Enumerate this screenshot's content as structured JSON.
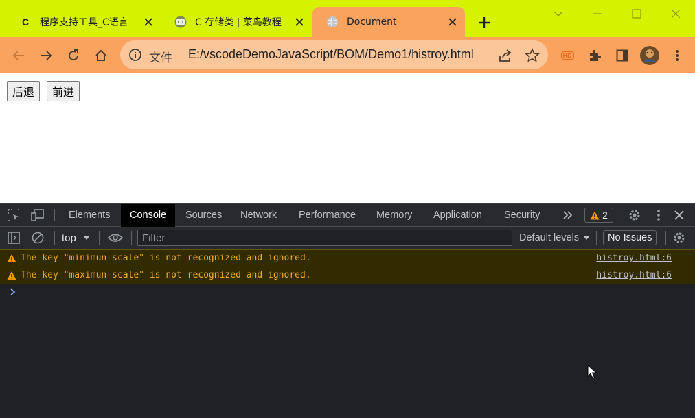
{
  "colors": {
    "tab_strip": "#d5f200",
    "toolbar": "#f9a35f",
    "omnibox": "#fbc69a",
    "devtools_bg": "#202124",
    "warning_text": "#f2ab26",
    "warning_bg": "#332b00"
  },
  "tabs": [
    {
      "icon": "c-letter-icon",
      "favicon_text": "C",
      "title": "程序支持工具_C语言",
      "active": false
    },
    {
      "icon": "code-icon",
      "title": "C 存储类 | 菜鸟教程",
      "active": false
    },
    {
      "icon": "globe-icon",
      "title": "Document",
      "active": true
    }
  ],
  "toolbar": {
    "omnibox_label": "文件",
    "url": "E:/vscodeDemoJavaScript/BOM/Demo1/histroy.html",
    "hd_badge": "HD"
  },
  "page": {
    "back_button": "后退",
    "forward_button": "前进"
  },
  "devtools": {
    "tabs": [
      "Elements",
      "Console",
      "Sources",
      "Network",
      "Performance",
      "Memory",
      "Application",
      "Security"
    ],
    "active_tab": "Console",
    "issues_count": "2",
    "context": "top",
    "filter_placeholder": "Filter",
    "levels": "Default levels",
    "no_issues": "No Issues",
    "messages": [
      {
        "level": "warning",
        "text": "The key \"minimun-scale\" is not recognized and ignored.",
        "source": "histroy.html:6"
      },
      {
        "level": "warning",
        "text": "The key \"maximun-scale\" is not recognized and ignored.",
        "source": "histroy.html:6"
      }
    ]
  }
}
